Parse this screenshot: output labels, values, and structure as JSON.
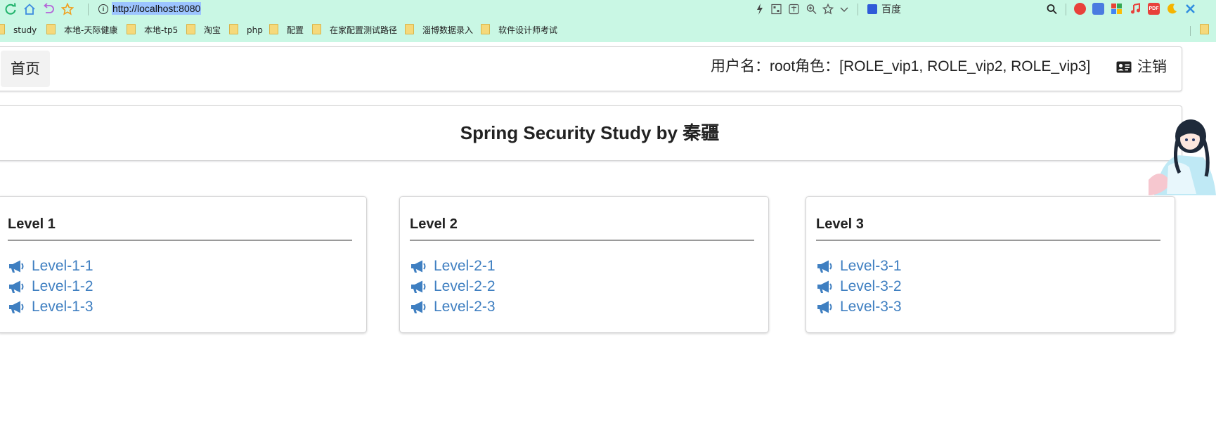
{
  "browser": {
    "url": "http://localhost:8080",
    "search_engine": "百度",
    "bookmarks": [
      {
        "label": "study"
      },
      {
        "label": "本地-天际健康"
      },
      {
        "label": "本地-tp5"
      },
      {
        "label": "淘宝"
      },
      {
        "label": "php"
      },
      {
        "label": "配置"
      },
      {
        "label": "在家配置测试路径"
      },
      {
        "label": "淄博数据录入"
      },
      {
        "label": "软件设计师考试"
      }
    ]
  },
  "navbar": {
    "home_label": "首页",
    "user_info": "用户名：root角色：[ROLE_vip1, ROLE_vip2, ROLE_vip3]",
    "logout_label": "注销"
  },
  "title": "Spring Security Study by 秦疆",
  "levels": [
    {
      "title": "Level 1",
      "links": [
        "Level-1-1",
        "Level-1-2",
        "Level-1-3"
      ]
    },
    {
      "title": "Level 2",
      "links": [
        "Level-2-1",
        "Level-2-2",
        "Level-2-3"
      ]
    },
    {
      "title": "Level 3",
      "links": [
        "Level-3-1",
        "Level-3-2",
        "Level-3-3"
      ]
    }
  ],
  "colors": {
    "chrome_bg": "#c9f7e4",
    "link": "#3f7fc1",
    "url_highlight": "#9cc4ff"
  },
  "icons": {
    "link_icon": "bullhorn-icon",
    "logout_icon": "id-card-icon"
  }
}
